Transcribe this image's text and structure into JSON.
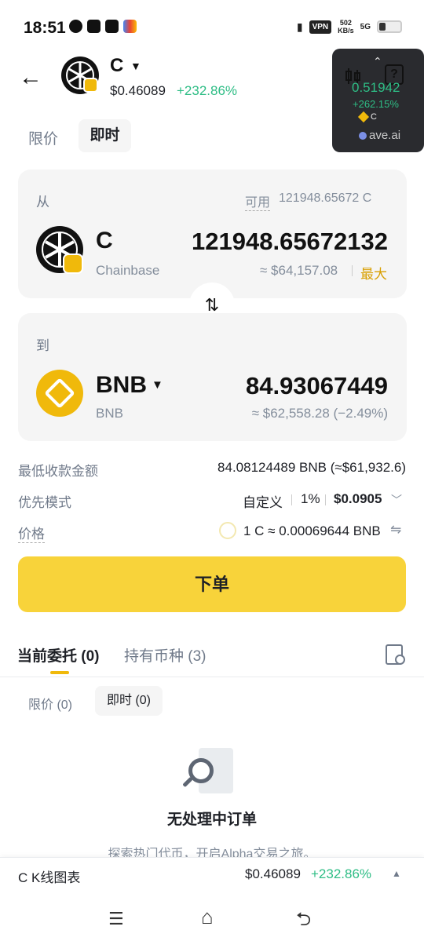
{
  "status_bar": {
    "time": "18:51",
    "vpn": "VPN",
    "net_speed_top": "502",
    "net_speed_bottom": "KB/s",
    "signal": "5G"
  },
  "header": {
    "symbol": "C",
    "price": "$0.46089",
    "change": "+232.86%",
    "change_color": "#2ebd85"
  },
  "overlay": {
    "price": "0.51942",
    "change": "+262.15%",
    "symbol": "C",
    "brand": "ave.ai"
  },
  "order_tabs": {
    "limit": "限价",
    "instant": "即时"
  },
  "from_card": {
    "label": "从",
    "available_label": "可用",
    "available_value": "121948.65672 C",
    "symbol": "C",
    "name": "Chainbase",
    "amount": "121948.65672132",
    "usd": "≈ $64,157.08",
    "max": "最大"
  },
  "to_card": {
    "label": "到",
    "symbol": "BNB",
    "name": "BNB",
    "amount": "84.93067449",
    "usd": "≈ $62,558.28 (−2.49%)"
  },
  "info": {
    "min_receive_label": "最低收款金额",
    "min_receive_value": "84.08124489 BNB (≈$61,932.6)",
    "priority_label": "优先模式",
    "priority_mode": "自定义",
    "priority_pct": "1%",
    "priority_fee": "$0.0905",
    "price_label": "价格",
    "price_value": "1 C ≈ 0.00069644 BNB"
  },
  "order_button": "下单",
  "bottom_tabs": {
    "current": "当前委托 (0)",
    "holdings": "持有币种 (3)"
  },
  "sub_tabs": {
    "limit": "限价 (0)",
    "instant": "即时 (0)"
  },
  "empty_state": {
    "title": "无处理中订单",
    "subtitle": "探索热门代币，开启Alpha交易之旅。"
  },
  "kline_bar": {
    "title": "C K线图表",
    "price": "$0.46089",
    "change": "+232.86%"
  },
  "colors": {
    "accent": "#f8d33a",
    "positive": "#2ebd85",
    "bnb": "#f0b90b"
  }
}
